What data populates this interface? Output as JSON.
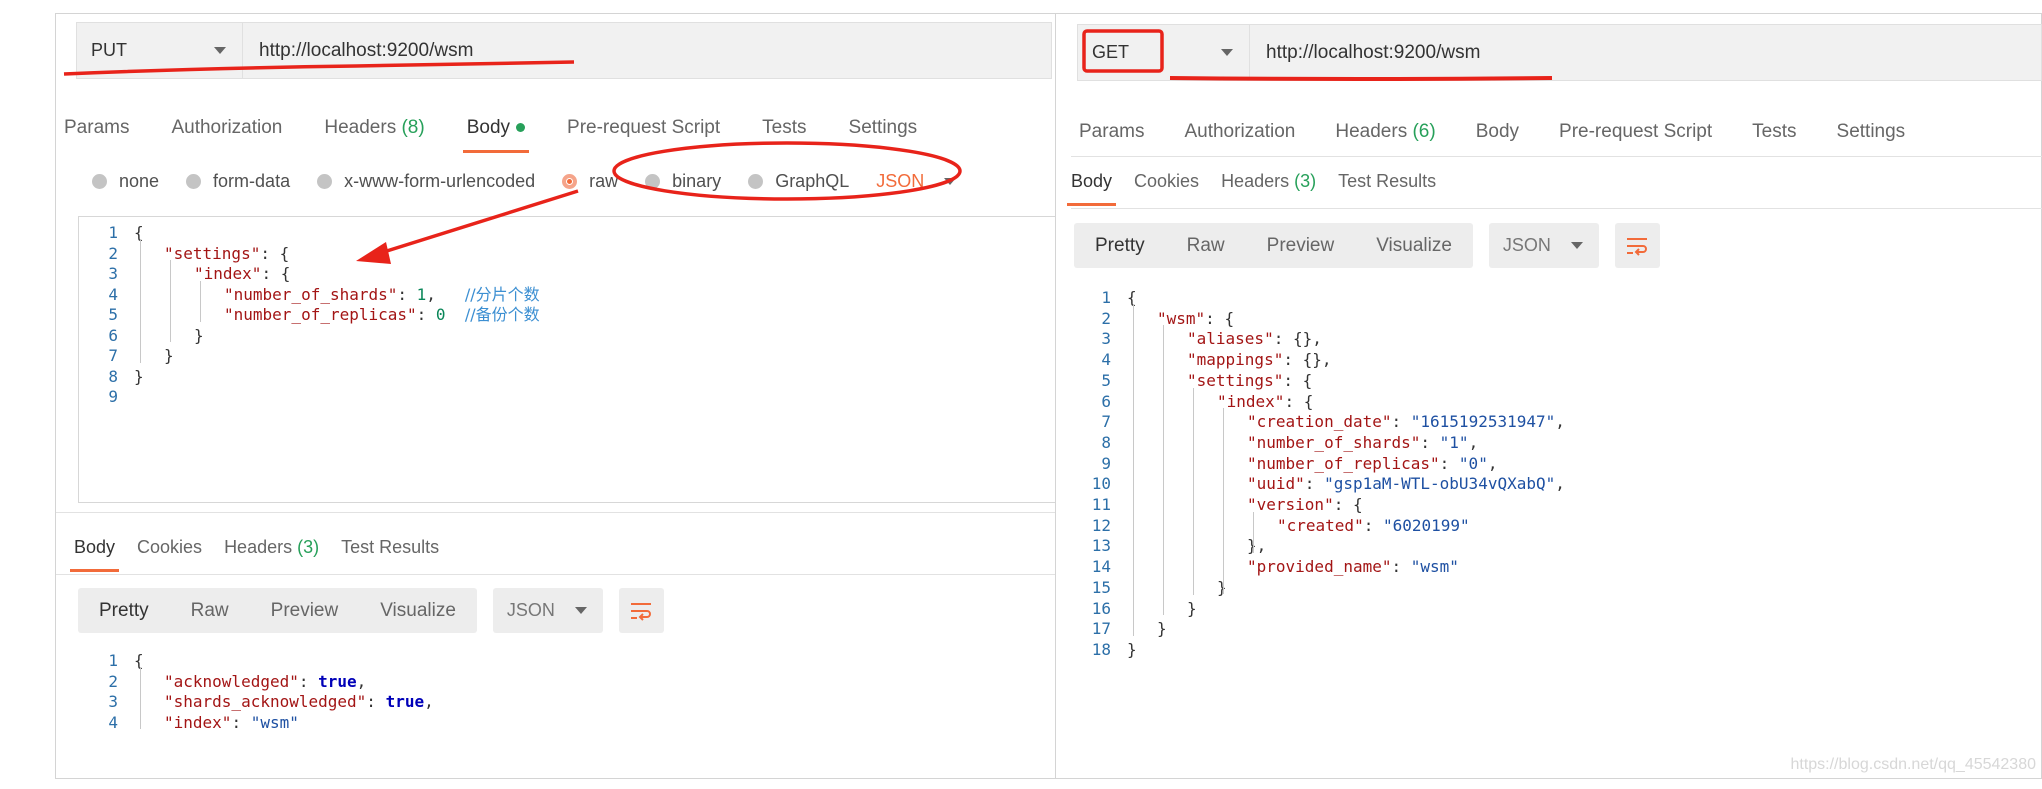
{
  "left": {
    "request": {
      "method": "PUT",
      "url": "http://localhost:9200/wsm",
      "tabs": [
        {
          "label": "Params"
        },
        {
          "label": "Authorization"
        },
        {
          "label": "Headers",
          "count": "(8)"
        },
        {
          "label": "Body",
          "active": true
        },
        {
          "label": "Pre-request Script"
        },
        {
          "label": "Tests"
        },
        {
          "label": "Settings"
        }
      ],
      "body_modes": [
        "none",
        "form-data",
        "x-www-form-urlencoded",
        "raw",
        "binary",
        "GraphQL"
      ],
      "selected_mode": "raw",
      "format": "JSON",
      "code": [
        {
          "n": "1",
          "t": "{"
        },
        {
          "n": "2",
          "k": "\"settings\"",
          "r": ": {"
        },
        {
          "n": "3",
          "k": "\"index\"",
          "r": ": {"
        },
        {
          "n": "4",
          "k": "\"number_of_shards\"",
          "r": ": ",
          "v": "1",
          "r2": ",   ",
          "c": "//分片个数"
        },
        {
          "n": "5",
          "k": "\"number_of_replicas\"",
          "r": ": ",
          "v": "0",
          "r2": "  ",
          "c": "//备份个数"
        },
        {
          "n": "6",
          "t": "}"
        },
        {
          "n": "7",
          "t": "}"
        },
        {
          "n": "8",
          "t": "}"
        },
        {
          "n": "9",
          "t": ""
        }
      ]
    },
    "response": {
      "tabs": [
        {
          "label": "Body",
          "active": true
        },
        {
          "label": "Cookies"
        },
        {
          "label": "Headers",
          "count": "(3)"
        },
        {
          "label": "Test Results"
        }
      ],
      "views": [
        "Pretty",
        "Raw",
        "Preview",
        "Visualize"
      ],
      "format": "JSON",
      "code": [
        {
          "n": "1",
          "t": "{"
        },
        {
          "n": "2",
          "k": "\"acknowledged\"",
          "r": ": ",
          "b": "true",
          "r2": ","
        },
        {
          "n": "3",
          "k": "\"shards_acknowledged\"",
          "r": ": ",
          "b": "true",
          "r2": ","
        },
        {
          "n": "4",
          "k": "\"index\"",
          "r": ": ",
          "s": "\"wsm\""
        }
      ]
    }
  },
  "right": {
    "request": {
      "method": "GET",
      "url": "http://localhost:9200/wsm",
      "tabs": [
        {
          "label": "Params"
        },
        {
          "label": "Authorization"
        },
        {
          "label": "Headers",
          "count": "(6)"
        },
        {
          "label": "Body"
        },
        {
          "label": "Pre-request Script"
        },
        {
          "label": "Tests"
        },
        {
          "label": "Settings"
        }
      ]
    },
    "response": {
      "tabs": [
        {
          "label": "Body",
          "active": true
        },
        {
          "label": "Cookies"
        },
        {
          "label": "Headers",
          "count": "(3)"
        },
        {
          "label": "Test Results"
        }
      ],
      "views": [
        "Pretty",
        "Raw",
        "Preview",
        "Visualize"
      ],
      "format": "JSON",
      "code": [
        {
          "n": "1",
          "t": "{"
        },
        {
          "n": "2",
          "k": "\"wsm\"",
          "r": ": {"
        },
        {
          "n": "3",
          "k": "\"aliases\"",
          "r": ": {},"
        },
        {
          "n": "4",
          "k": "\"mappings\"",
          "r": ": {},"
        },
        {
          "n": "5",
          "k": "\"settings\"",
          "r": ": {"
        },
        {
          "n": "6",
          "k": "\"index\"",
          "r": ": {"
        },
        {
          "n": "7",
          "k": "\"creation_date\"",
          "r": ": ",
          "s": "\"1615192531947\"",
          "r2": ","
        },
        {
          "n": "8",
          "k": "\"number_of_shards\"",
          "r": ": ",
          "s": "\"1\"",
          "r2": ","
        },
        {
          "n": "9",
          "k": "\"number_of_replicas\"",
          "r": ": ",
          "s": "\"0\"",
          "r2": ","
        },
        {
          "n": "10",
          "k": "\"uuid\"",
          "r": ": ",
          "s": "\"gsp1aM-WTL-obU34vQXabQ\"",
          "r2": ","
        },
        {
          "n": "11",
          "k": "\"version\"",
          "r": ": {"
        },
        {
          "n": "12",
          "k": "\"created\"",
          "r": ": ",
          "s": "\"6020199\""
        },
        {
          "n": "13",
          "t": "},"
        },
        {
          "n": "14",
          "k": "\"provided_name\"",
          "r": ": ",
          "s": "\"wsm\""
        },
        {
          "n": "15",
          "t": "}"
        },
        {
          "n": "16",
          "t": "}"
        },
        {
          "n": "17",
          "t": "}"
        },
        {
          "n": "18",
          "t": "}"
        }
      ]
    }
  },
  "watermark": "https://blog.csdn.net/qq_45542380",
  "colors": {
    "accent": "#f26b3a",
    "green": "#27a05a",
    "annotation": "#e8231a"
  }
}
